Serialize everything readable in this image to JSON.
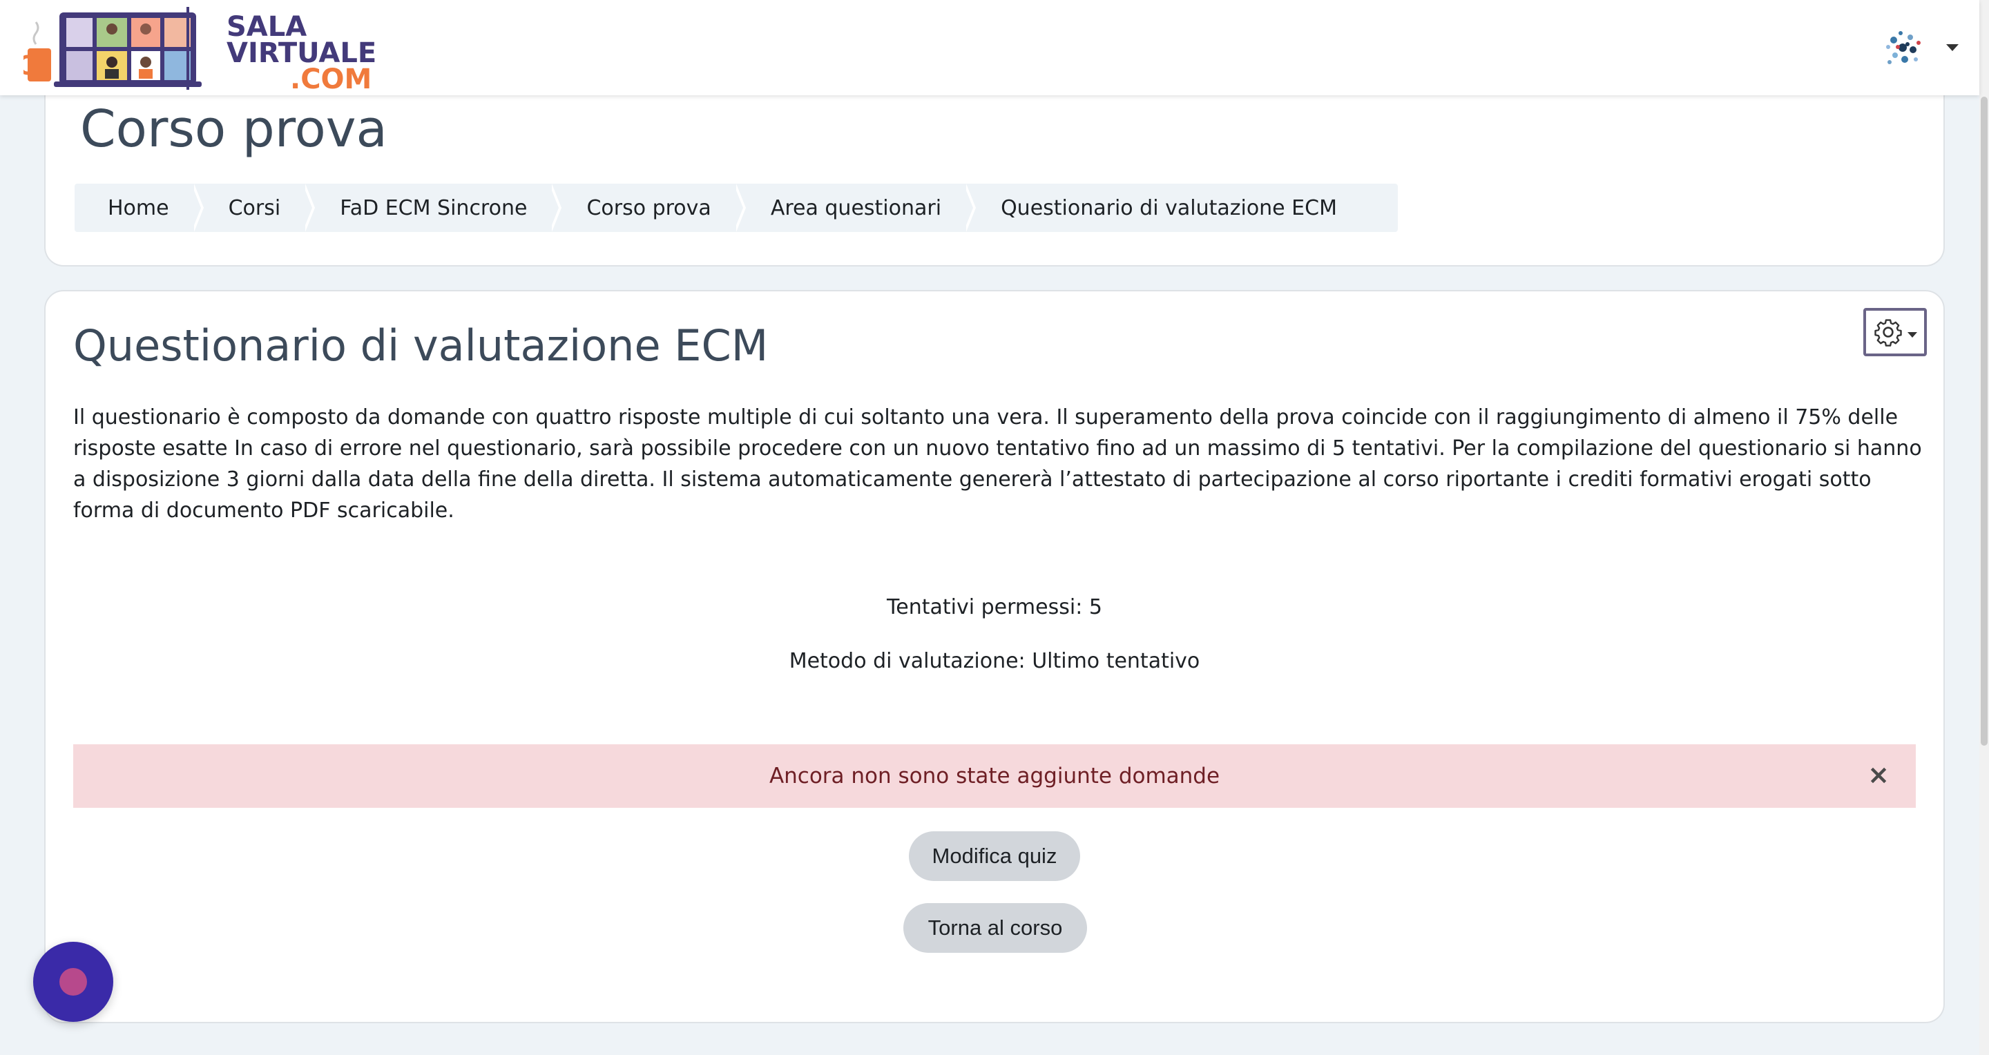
{
  "brand": {
    "line1": "SALA",
    "line2": "VIRTUALE",
    "line3": ".COM",
    "colors": {
      "primary": "#433a7a",
      "accent": "#f07a3c"
    }
  },
  "header": {
    "course_title": "Corso prova",
    "breadcrumb": [
      "Home",
      "Corsi",
      "FaD ECM Sincrone",
      "Corso prova",
      "Area questionari",
      "Questionario di valutazione ECM"
    ]
  },
  "main": {
    "title": "Questionario di valutazione ECM",
    "intro": "Il questionario è composto da domande con quattro risposte multiple di cui soltanto una vera. Il superamento della prova coincide con il raggiungimento di almeno il 75% delle risposte esatte In caso di errore nel questionario, sarà possibile procedere con un nuovo tentativo fino ad un massimo di 5 tentativi. Per la compilazione del questionario si hanno a disposizione 3 giorni dalla data della fine della diretta. Il sistema automaticamente genererà l’attestato di partecipazione al corso riportante i crediti formativi erogati sotto forma di documento PDF scaricabile.",
    "attempts": "Tentativi permessi: 5",
    "grading": "Metodo di valutazione: Ultimo tentativo",
    "alert": {
      "text": "Ancora non sono state aggiunte domande",
      "close": "×",
      "color": "#f6d9dc"
    },
    "buttons": {
      "edit_quiz": "Modifica quiz",
      "back_to_course": "Torna al corso"
    }
  },
  "icons": {
    "settings": "gear-icon",
    "user": "avatar-icon",
    "fab": "chat-bubble-icon"
  }
}
